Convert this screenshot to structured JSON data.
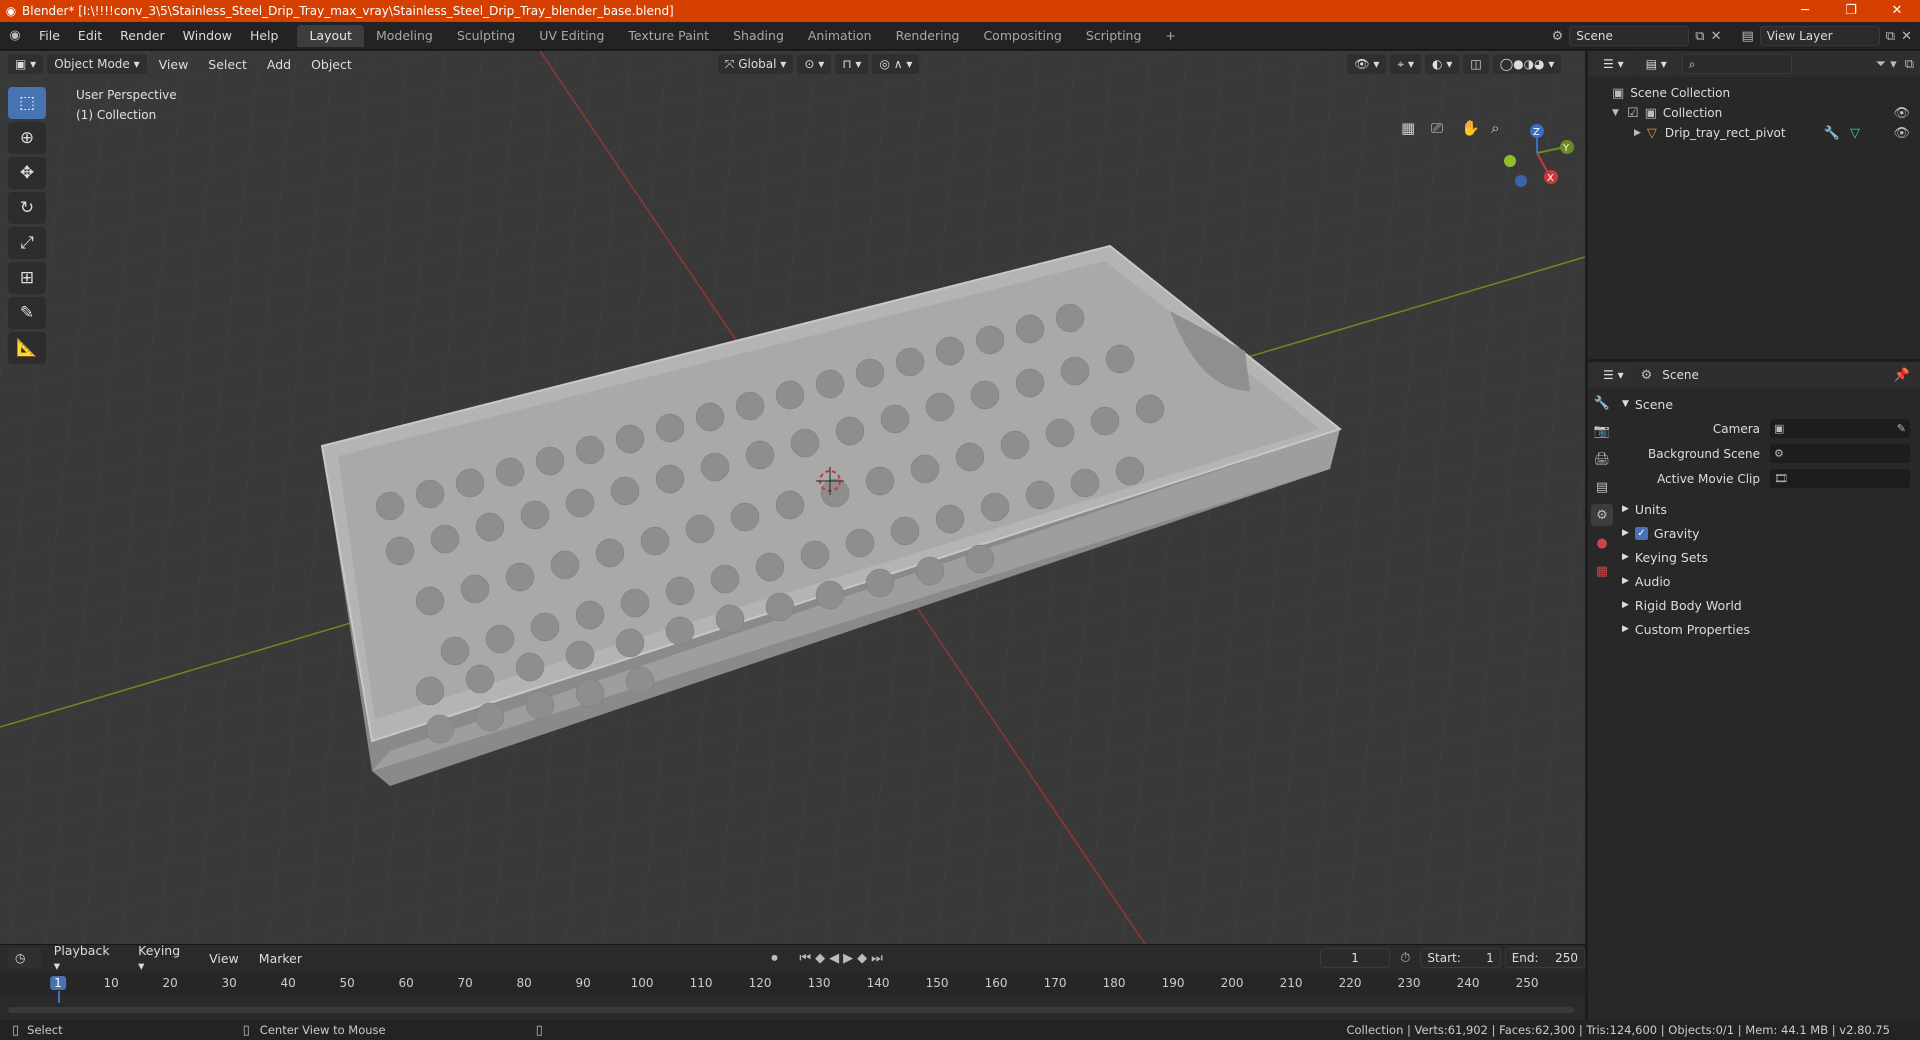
{
  "title": "Blender* [I:\\!!!!conv_3\\5\\Stainless_Steel_Drip_Tray_max_vray\\Stainless_Steel_Drip_Tray_blender_base.blend]",
  "window_controls": {
    "minimize": "─",
    "maximize": "❐",
    "close": "✕"
  },
  "menu": [
    "File",
    "Edit",
    "Render",
    "Window",
    "Help"
  ],
  "workspaces": [
    "Layout",
    "Modeling",
    "Sculpting",
    "UV Editing",
    "Texture Paint",
    "Shading",
    "Animation",
    "Rendering",
    "Compositing",
    "Scripting"
  ],
  "add_workspace": "+",
  "scene_name": "Scene",
  "view_layer": "View Layer",
  "viewport": {
    "mode": "Object Mode",
    "menus": [
      "View",
      "Select",
      "Add",
      "Object"
    ],
    "transform_orientation": "Global",
    "info_line1": "User Perspective",
    "info_line2": "(1) Collection",
    "axes": {
      "z": "Z",
      "y": "Y",
      "x": "X"
    }
  },
  "outliner": {
    "root": "Scene Collection",
    "collection": "Collection",
    "object": "Drip_tray_rect_pivot"
  },
  "properties": {
    "header": "Scene",
    "section": "Scene",
    "fields": [
      {
        "label": "Camera",
        "value": ""
      },
      {
        "label": "Background Scene",
        "value": ""
      },
      {
        "label": "Active Movie Clip",
        "value": ""
      }
    ],
    "panels": [
      "Units",
      "Gravity",
      "Keying Sets",
      "Audio",
      "Rigid Body World",
      "Custom Properties"
    ],
    "gravity_checked": true
  },
  "timeline": {
    "menus": [
      "Playback",
      "Keying",
      "View",
      "Marker"
    ],
    "current_frame": "1",
    "start_label": "Start:",
    "start": "1",
    "end_label": "End:",
    "end": "250",
    "ruler": [
      "1",
      "10",
      "20",
      "30",
      "40",
      "50",
      "60",
      "70",
      "80",
      "90",
      "100",
      "110",
      "120",
      "130",
      "140",
      "150",
      "160",
      "170",
      "180",
      "190",
      "200",
      "210",
      "220",
      "230",
      "240",
      "250"
    ]
  },
  "status": {
    "left_action": "Select",
    "mid_action": "Center View to Mouse",
    "stats": "Collection | Verts:61,902 | Faces:62,300 | Tris:124,600 | Objects:0/1 | Mem: 44.1 MB | v2.80.75"
  },
  "colors": {
    "accent": "#4772b3",
    "titlebar": "#d54000",
    "x_axis": "#c83a3a",
    "y_axis": "#7a9a2a"
  }
}
